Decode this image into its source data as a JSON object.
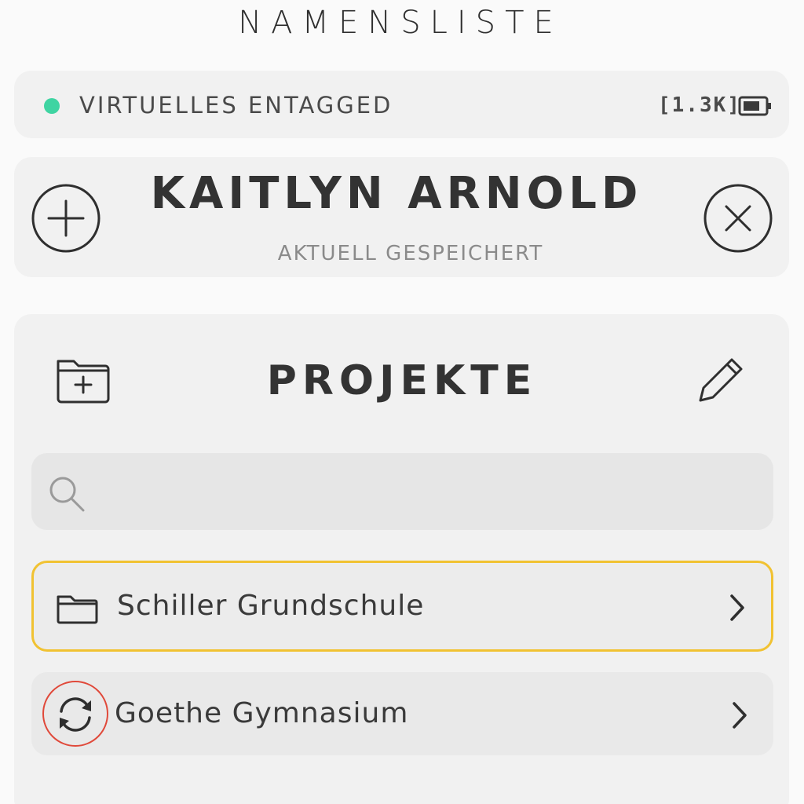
{
  "header": {
    "title": "NAMENSLISTE"
  },
  "status": {
    "label": "VIRTUELLES ENTAGGED",
    "dot_color": "#3fd4a2",
    "size": "[1.3K]",
    "battery_icon": "battery-icon"
  },
  "user": {
    "name": "KAITLYN ARNOLD",
    "status": "AKTUELL GESPEICHERT",
    "add_icon": "plus-circle-icon",
    "close_icon": "close-circle-icon"
  },
  "projects": {
    "title": "PROJEKTE",
    "new_folder_icon": "folder-plus-icon",
    "edit_icon": "pencil-icon",
    "search": {
      "placeholder": "",
      "value": "",
      "icon": "search-icon"
    },
    "items": [
      {
        "label": "Schiller Grundschule",
        "icon": "folder-icon",
        "selected": true,
        "accent_color": "#f1c232"
      },
      {
        "label": "Goethe Gymnasium",
        "icon": "sync-icon",
        "selected": false,
        "highlight_color": "#e0493a"
      }
    ]
  }
}
